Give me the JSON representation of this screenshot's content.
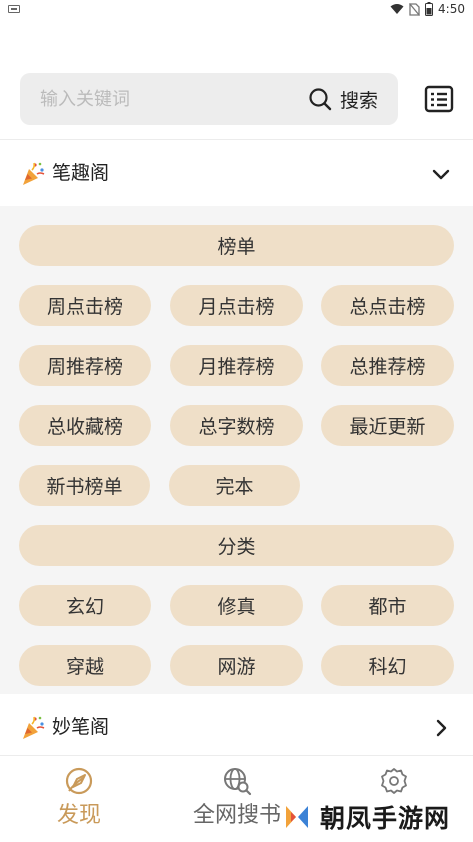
{
  "status_bar": {
    "time": "4:50"
  },
  "search": {
    "placeholder": "输入关键词",
    "button_label": "搜索"
  },
  "groups": [
    {
      "title": "笔趣阁"
    },
    {
      "title": "妙笔阁"
    }
  ],
  "panel": {
    "rows": [
      [
        "榜单"
      ],
      [
        "周点击榜",
        "月点击榜",
        "总点击榜"
      ],
      [
        "周推荐榜",
        "月推荐榜",
        "总推荐榜"
      ],
      [
        "总收藏榜",
        "总字数榜",
        "最近更新"
      ],
      [
        "新书榜单",
        "完本"
      ],
      [
        "分类"
      ],
      [
        "玄幻",
        "修真",
        "都市"
      ],
      [
        "穿越",
        "网游",
        "科幻"
      ]
    ]
  },
  "bottom_nav": {
    "discover": "发现",
    "global_search": "全网搜书",
    "settings": ""
  },
  "watermark": {
    "text": "朝凤手游网"
  },
  "colors": {
    "accent": "#c99a5a",
    "pill_bg": "#efdfc8",
    "panel_bg": "#f5f5f5"
  }
}
